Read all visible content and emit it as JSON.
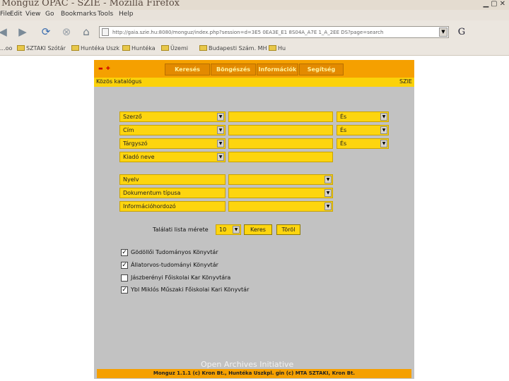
{
  "window": {
    "title": "Mongúz OPAC - SZIE - Mozilla Firefox"
  },
  "menu": [
    "File",
    "Edit",
    "View",
    "Go",
    "Bookmarks",
    "Tools",
    "Help"
  ],
  "address": {
    "url": "http://gaia.szie.hu:8080/monguz/index.php?session=d=3E5 0EA3E_E1 8S04A_A7E 1_A_2EE DS?page=search"
  },
  "bookmarks": [
    "...oo",
    "SZTAKI Szótár",
    "Huntéka Uszk",
    "Huntéka",
    "Üzemi",
    "Budapesti Szám. MH",
    "Hu"
  ],
  "page": {
    "flags": "▬ ✚",
    "tabs": [
      "Keresés",
      "Böngészés",
      "Információk",
      "Segítség"
    ],
    "catalog_left": "Közös katalógus",
    "catalog_right": "SZIE",
    "search_rows": [
      {
        "field": "Szerző",
        "op": "És"
      },
      {
        "field": "Cím",
        "op": "És"
      },
      {
        "field": "Tárgyszó",
        "op": "És"
      },
      {
        "field": "Kiadó neve",
        "op": ""
      }
    ],
    "filters": [
      "Nyelv",
      "Dokumentum típusa",
      "Információhordozó"
    ],
    "results_label": "Találati lista mérete",
    "results_size": "10",
    "search_btn": "Keres",
    "clear_btn": "Töröl",
    "libraries": [
      {
        "label": "Gödöllői Tudományos Könyvtár",
        "checked": true
      },
      {
        "label": "Állatorvos-tudományi Könyvtár",
        "checked": true
      },
      {
        "label": "Jászberényi Főiskolai Kar Könyvtára",
        "checked": false
      },
      {
        "label": "Ybl Miklós Műszaki Főiskolai Kari Könyvtár",
        "checked": true
      }
    ],
    "watermark": "Open Archives Initiative",
    "footer": "Monguz 1.1.1 (c) Kron Bt., Huntéka Uszkpl. gin (c) MTA SZTAKI, Kron Bt."
  },
  "colors": {
    "orange": "#f5a000",
    "yellow": "#fdd50f",
    "frame_gray": "#c2c2c2"
  }
}
